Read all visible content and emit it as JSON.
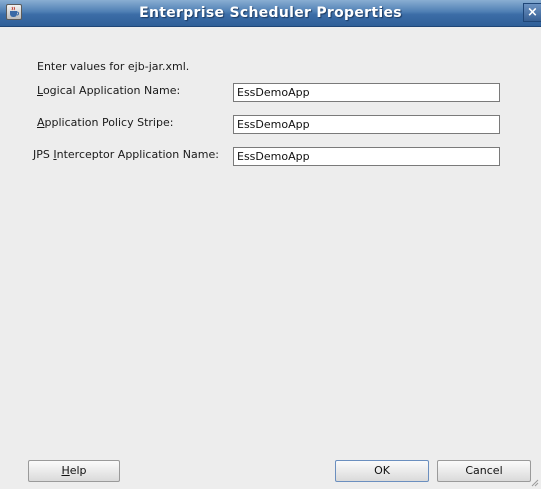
{
  "window": {
    "title": "Enterprise Scheduler Properties",
    "close_glyph": "×"
  },
  "intro_text": "Enter values for ejb-jar.xml.",
  "fields": [
    {
      "mnemonic": "L",
      "label_rest": "ogical Application Name:",
      "value": "EssDemoApp"
    },
    {
      "mnemonic": "A",
      "label_rest": "pplication Policy Stripe:",
      "value": "EssDemoApp"
    },
    {
      "label_prefix": "JPS ",
      "mnemonic": "I",
      "label_rest": "nterceptor Application Name:",
      "value": "EssDemoApp"
    }
  ],
  "buttons": {
    "help_mnemonic": "H",
    "help_rest": "elp",
    "ok": "OK",
    "cancel": "Cancel"
  },
  "icons": {
    "title_icon": "java-cup-icon",
    "close": "close-icon",
    "resize": "resize-grip-icon"
  }
}
